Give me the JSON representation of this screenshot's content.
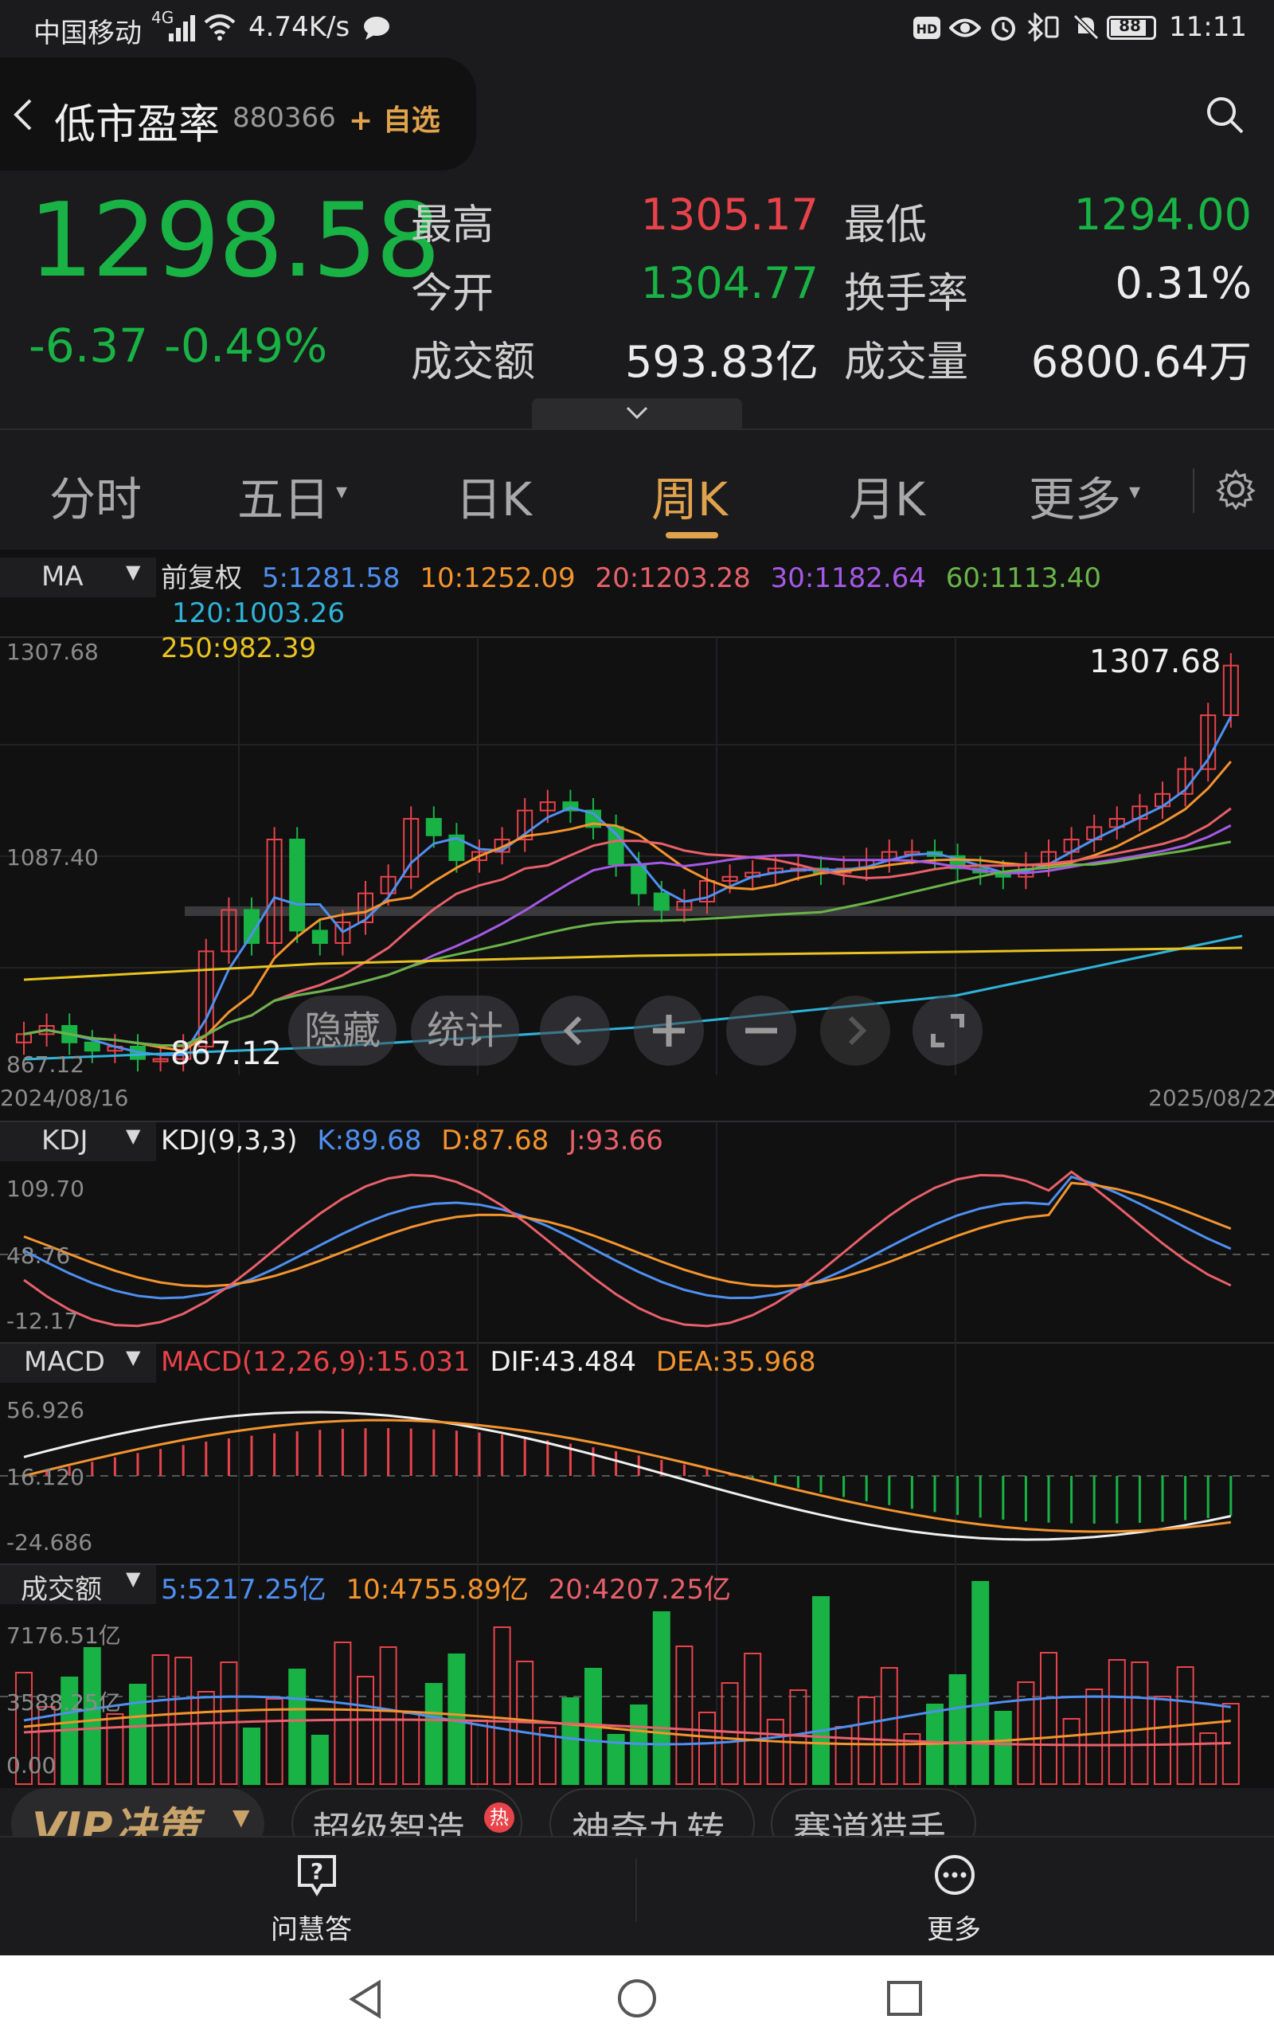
{
  "status_bar": {
    "carrier": "中国移动",
    "net": "4G",
    "speed": "4.74K/s",
    "battery": "88",
    "time": "11:11"
  },
  "header": {
    "back_icon": "chevron-left-icon",
    "name": "低市盈率",
    "code": "880366",
    "add_watch": "+ 自选",
    "search_icon": "search-icon"
  },
  "quote": {
    "price": "1298.58",
    "change": "-6.37",
    "change_pct": "-0.49%",
    "high_label": "最高",
    "high": "1305.17",
    "low_label": "最低",
    "low": "1294.00",
    "open_label": "今开",
    "open": "1304.77",
    "turnover_rate_label": "换手率",
    "turnover_rate": "0.31%",
    "amount_label": "成交额",
    "amount": "593.83亿",
    "volume_label": "成交量",
    "volume": "6800.64万"
  },
  "tabs": {
    "items": [
      "分时",
      "五日",
      "日K",
      "周K",
      "月K",
      "更多"
    ],
    "active": "周K"
  },
  "main_chart": {
    "indicator": "MA",
    "adjust": "前复权",
    "ma5": "5:1281.58",
    "ma10": "10:1252.09",
    "ma20": "20:1203.28",
    "ma30": "30:1182.64",
    "ma60": "60:1113.40",
    "ma120": "120:1003.26",
    "ma250": "250:982.39",
    "y_top": "1307.68",
    "y_mid": "1087.40",
    "y_bottom": "867.12",
    "max_label": "1307.68",
    "min_label": "867.12",
    "date_start": "2024/08/16",
    "date_end": "2025/08/22",
    "btn_hide": "隐藏",
    "btn_stats": "统计"
  },
  "kdj": {
    "name": "KDJ",
    "params": "KDJ(9,3,3)",
    "k": "K:89.68",
    "d": "D:87.68",
    "j": "J:93.66",
    "y_top": "109.70",
    "y_mid": "48.76",
    "y_bottom": "-12.17"
  },
  "macd": {
    "name": "MACD",
    "params": "MACD(12,26,9):15.031",
    "dif": "DIF:43.484",
    "dea": "DEA:35.968",
    "y_top": "56.926",
    "y_mid": "16.120",
    "y_bottom": "-24.686"
  },
  "amount_chart": {
    "name": "成交额",
    "ma5": "5:5217.25亿",
    "ma10": "10:4755.89亿",
    "ma20": "20:4207.25亿",
    "y_top": "7176.51亿",
    "y_mid": "3588.25亿",
    "y_bottom": "0.00"
  },
  "promo": {
    "vip": "VIP决策",
    "items": [
      "超级智造",
      "神奇九转",
      "赛道猎手"
    ],
    "hot": "热"
  },
  "bottom_actions": {
    "ask": "问慧答",
    "more": "更多"
  },
  "colors": {
    "up": "#e8434a",
    "down": "#19b244",
    "ma5": "#4f8ff0",
    "ma10": "#f3942e",
    "ma20": "#e8606a",
    "ma30": "#a659e6",
    "ma60": "#69b448",
    "ma120": "#2fb3d9",
    "ma250": "#e8c321",
    "accent": "#e0a24c"
  }
}
